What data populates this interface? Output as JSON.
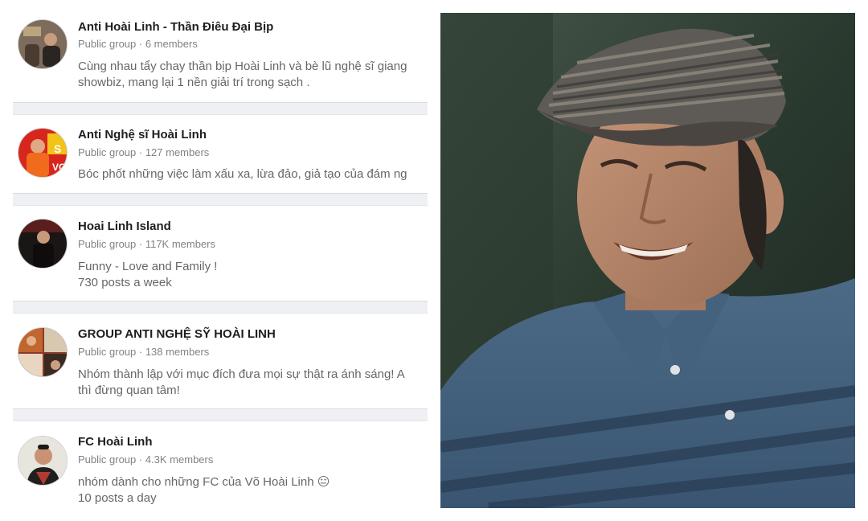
{
  "groups": [
    {
      "name": "Anti Hoài Linh - Thần Điêu Đại Bịp",
      "meta": "Public group · 6 members",
      "desc1": "Cùng nhau tẩy chay thần bịp Hoài Linh và bè lũ nghệ sĩ giang",
      "desc2": "showbiz, mang lại 1 nền giải trí trong sạch ."
    },
    {
      "name": "Anti Nghệ sĩ Hoài Linh",
      "meta": "Public group · 127 members",
      "desc1": "Bóc phốt những việc làm xấu xa, lừa đảo, giả tạo của đám ng",
      "desc2": ""
    },
    {
      "name": "Hoai Linh Island",
      "meta": "Public group · 117K members",
      "desc1": "Funny - Love and Family !",
      "desc2": "730 posts a week"
    },
    {
      "name": "GROUP ANTI NGHỆ SỸ HOÀI LINH",
      "meta": "Public group · 138 members",
      "desc1": "Nhóm thành lập với mục đích đưa mọi sự thật ra ánh sáng! A",
      "desc2": "thì đừng quan tâm!"
    },
    {
      "name": "FC Hoài Linh",
      "meta": "Public group · 4.3K members",
      "desc1": "nhóm dành cho những FC của Võ Hoài Linh 😐",
      "desc2": "10 posts a day"
    }
  ],
  "photo": {
    "subject": "smiling man wearing a striped flat cap and blue striped polo shirt"
  }
}
